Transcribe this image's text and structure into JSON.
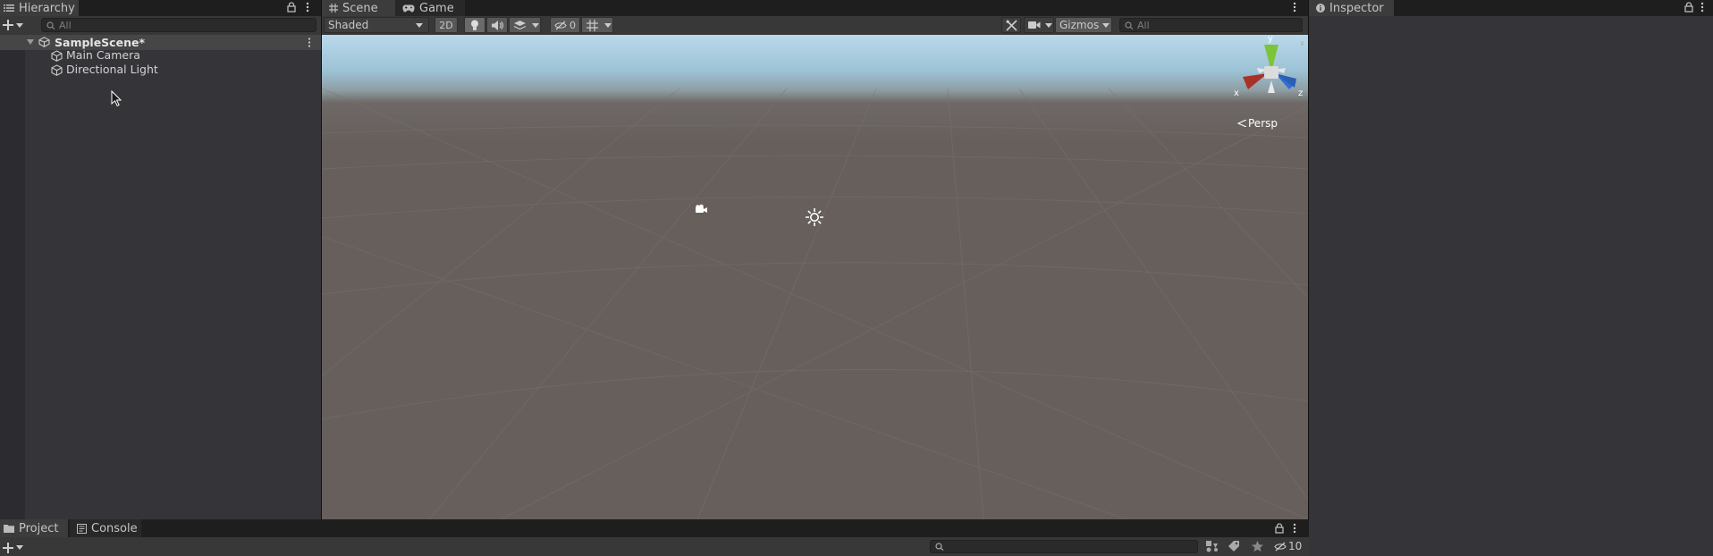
{
  "hierarchy": {
    "tab_label": "Hierarchy",
    "search_placeholder": "All",
    "scene_name": "SampleScene*",
    "items": [
      {
        "label": "Main Camera",
        "icon": "gameobject-cube-icon"
      },
      {
        "label": "Directional Light",
        "icon": "gameobject-cube-icon"
      }
    ]
  },
  "scene_view": {
    "tabs": [
      {
        "label": "Scene",
        "icon": "grid-icon"
      },
      {
        "label": "Game",
        "icon": "gamepad-icon"
      }
    ],
    "shading_mode": "Shaded",
    "mode_2d_label": "2D",
    "hidden_count": "0",
    "gizmos_label": "Gizmos",
    "search_placeholder": "All",
    "projection_label": "Persp",
    "axis_labels": {
      "x": "x",
      "y": "y",
      "z": "z"
    },
    "colors": {
      "sky_top": "#b8d9ea",
      "ground": "#665f5c",
      "x_axis": "#c0392b",
      "y_axis": "#7cc43a",
      "z_axis": "#2f6fd6"
    }
  },
  "inspector": {
    "tab_label": "Inspector"
  },
  "bottom": {
    "tabs": [
      {
        "label": "Project",
        "icon": "folder-icon"
      },
      {
        "label": "Console",
        "icon": "console-icon"
      }
    ],
    "hidden_packages_count": "10"
  }
}
